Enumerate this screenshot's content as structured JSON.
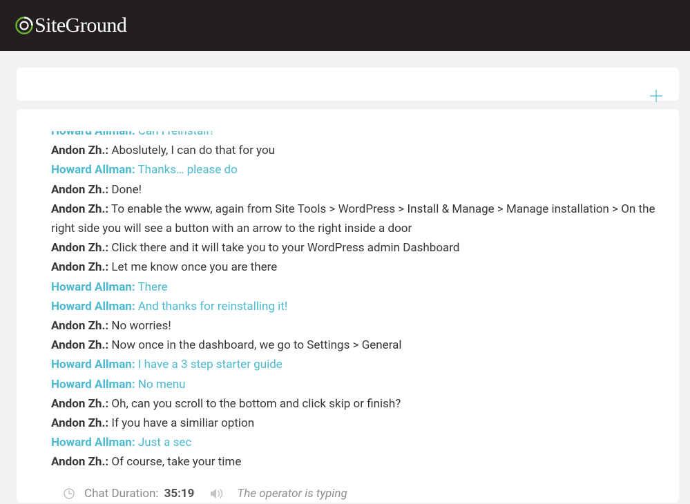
{
  "brand": {
    "name": "SiteGround"
  },
  "messages": [
    {
      "role": "customer",
      "author": "Howard Allman:",
      "text": "Can I reinstall?"
    },
    {
      "role": "agent",
      "author": "Andon Zh.:",
      "text": "Aboslutely, I can do that for you"
    },
    {
      "role": "customer",
      "author": "Howard Allman:",
      "text": "Thanks… please do"
    },
    {
      "role": "agent",
      "author": "Andon Zh.:",
      "text": "Done!"
    },
    {
      "role": "agent",
      "author": "Andon Zh.:",
      "text": "To enable the www, again from Site Tools > WordPress > Install & Manage > Manage installation > On the right side you will see a button with an arrow to the right inside a door"
    },
    {
      "role": "agent",
      "author": "Andon Zh.:",
      "text": "Click there and it will take you to your WordPress admin Dashboard"
    },
    {
      "role": "agent",
      "author": "Andon Zh.:",
      "text": "Let me know once you are there"
    },
    {
      "role": "customer",
      "author": "Howard Allman:",
      "text": "There"
    },
    {
      "role": "customer",
      "author": "Howard Allman:",
      "text": "And thanks for reinstalling it!"
    },
    {
      "role": "agent",
      "author": "Andon Zh.:",
      "text": "No worries!"
    },
    {
      "role": "agent",
      "author": "Andon Zh.:",
      "text": "Now once in the dashboard, we go to Settings > General"
    },
    {
      "role": "customer",
      "author": "Howard Allman:",
      "text": "I have a 3 step starter guide"
    },
    {
      "role": "customer",
      "author": "Howard Allman:",
      "text": "No menu"
    },
    {
      "role": "agent",
      "author": "Andon Zh.:",
      "text": "Oh, can you scroll to the bottom and click skip or finish?"
    },
    {
      "role": "agent",
      "author": "Andon Zh.:",
      "text": "If you have a similiar option"
    },
    {
      "role": "customer",
      "author": "Howard Allman:",
      "text": "Just a sec"
    },
    {
      "role": "agent",
      "author": "Andon Zh.:",
      "text": "Of course, take your time"
    }
  ],
  "footer": {
    "duration_label": "Chat Duration: ",
    "duration_value": "35:19",
    "typing": "The operator is typing"
  }
}
